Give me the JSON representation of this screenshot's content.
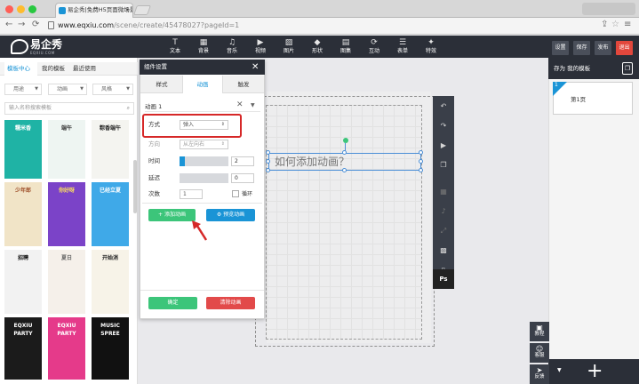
{
  "browser": {
    "tab_title": "易企秀|免费H5页面微场景制",
    "tab_close": "×",
    "address_host": "www.eqxiu.com",
    "address_path": "/scene/create/45478027?pageId=1"
  },
  "app": {
    "logo_text": "易企秀",
    "logo_sub": "EQXIU.COM",
    "tools": [
      {
        "icon": "T",
        "label": "文本"
      },
      {
        "icon": "▦",
        "label": "背景"
      },
      {
        "icon": "♫",
        "label": "音乐"
      },
      {
        "icon": "▶",
        "label": "视频"
      },
      {
        "icon": "▨",
        "label": "图片"
      },
      {
        "icon": "◆",
        "label": "形状"
      },
      {
        "icon": "▤",
        "label": "图集"
      },
      {
        "icon": "⟳",
        "label": "互动"
      },
      {
        "icon": "☰",
        "label": "表单"
      },
      {
        "icon": "✦",
        "label": "特效"
      }
    ],
    "header_buttons": [
      {
        "label": "设置",
        "color": "#4a4f5a"
      },
      {
        "label": "保存",
        "color": "#4a4f5a"
      },
      {
        "label": "发布",
        "color": "#4a4f5a"
      },
      {
        "label": "退出",
        "color": "#e2473c"
      }
    ]
  },
  "left_panel": {
    "tabs": [
      "模板中心",
      "我的模板",
      "最近使用"
    ],
    "filters": [
      "用途",
      "动画",
      "风格"
    ],
    "search_placeholder": "输入名称搜索模板",
    "thumbs": [
      {
        "text": "糯米香",
        "bg": "#1fb3a5",
        "fg": "#fff"
      },
      {
        "text": "端午",
        "bg": "#eef5f2",
        "fg": "#333"
      },
      {
        "text": "粽香端午",
        "bg": "#f4f4f0",
        "fg": "#222"
      },
      {
        "text": "少年郎",
        "bg": "#f1e4c7",
        "fg": "#a0522d"
      },
      {
        "text": "你好呀",
        "bg": "#7b43c8",
        "fg": "#ffe35a"
      },
      {
        "text": "已经立夏",
        "bg": "#3fa9e8",
        "fg": "#fff"
      },
      {
        "text": "招聘",
        "bg": "#f2f2f2",
        "fg": "#111"
      },
      {
        "text": "夏日",
        "bg": "#f5f0ea",
        "fg": "#666"
      },
      {
        "text": "开始消",
        "bg": "#f7f3e8",
        "fg": "#222"
      },
      {
        "text": "EQXIU PARTY",
        "bg": "#1b1b1b",
        "fg": "#fff"
      },
      {
        "text": "EQXIU PARTY",
        "bg": "#e53a8a",
        "fg": "#fff"
      },
      {
        "text": "MUSIC SPREE",
        "bg": "#111",
        "fg": "#fff"
      }
    ]
  },
  "dialog": {
    "title": "组件设置",
    "close": "✕",
    "tabs": [
      "样式",
      "动画",
      "触发"
    ],
    "active_tab": "动画",
    "anim_header": "动画 1",
    "rows": {
      "mode_label": "方式",
      "mode_value": "弹入",
      "dir_label": "方向",
      "dir_value": "从左向右",
      "time_label": "时间",
      "time_value": "2",
      "delay_label": "延迟",
      "delay_value": "0",
      "count_label": "次数",
      "count_value": "1",
      "loop_label": "循环"
    },
    "add_anim": "添加动画",
    "preview_anim": "预览动画",
    "confirm": "确定",
    "clear": "清除动画",
    "colors": {
      "green": "#3cc57a",
      "blue": "#1a94d6",
      "red": "#e24a4a"
    }
  },
  "canvas": {
    "text": "如何添加动画？"
  },
  "right_strip": {
    "icons": [
      "↶",
      "↷",
      "▶",
      "❐",
      "▦",
      "♪",
      "⤢",
      "▩",
      "▯"
    ],
    "ps_label": "Ps"
  },
  "right_panel": {
    "header": "存为 我的模板",
    "page_num": "1",
    "page_label": "第1页",
    "add": "+",
    "side_buttons": [
      {
        "icon": "▣",
        "label": "教程"
      },
      {
        "icon": "☺",
        "label": "客服"
      },
      {
        "icon": "➤",
        "label": "反馈"
      }
    ]
  }
}
